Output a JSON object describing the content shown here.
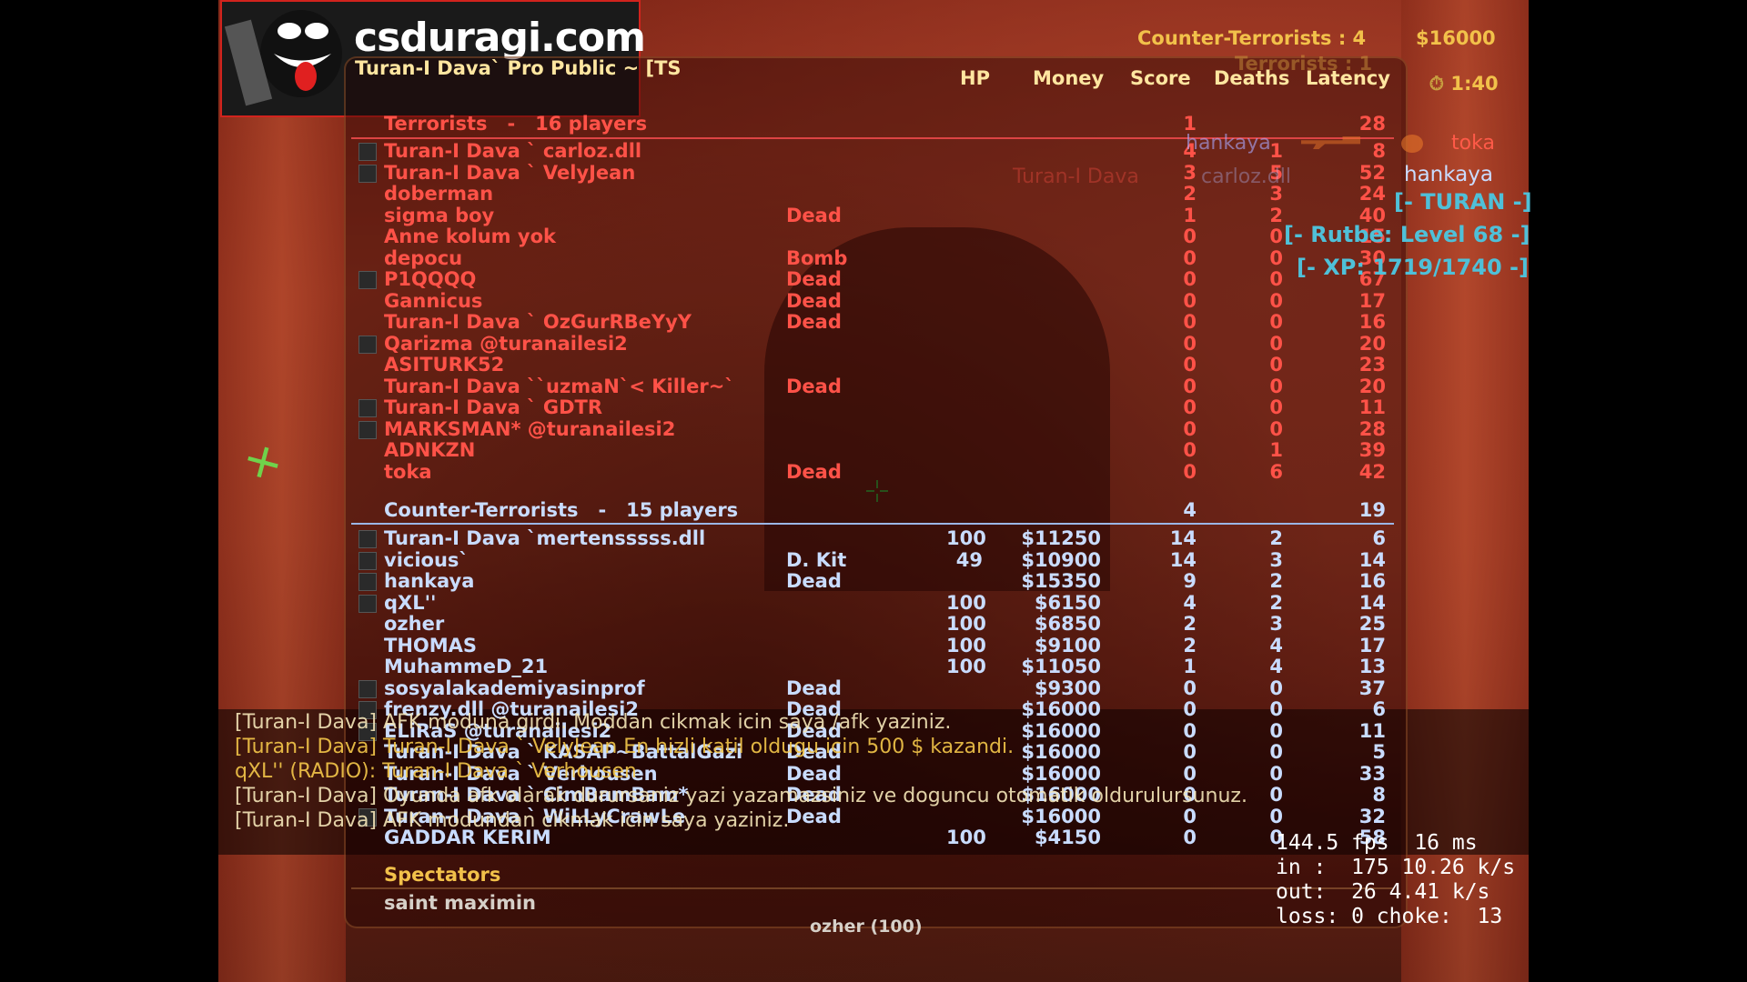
{
  "logo": {
    "text": "csduragi.com"
  },
  "server_name": "Turan-I Dava` Pro Public ~ [TS",
  "top_right": {
    "ct_score": "Counter-Terrorists : 4",
    "t_score": "Terrorists : 1",
    "money": "$16000",
    "timer": "1:40"
  },
  "columns": {
    "hp": "HP",
    "money": "Money",
    "score": "Score",
    "deaths": "Deaths",
    "latency": "Latency"
  },
  "terrorists": {
    "title": "Terrorists   -   16 players",
    "score": "1",
    "latency": "28",
    "players": [
      {
        "name": "Turan-I Dava ` carloz.dll",
        "status": "",
        "hp": "",
        "money": "",
        "score": "4",
        "deaths": "1",
        "latency": "8",
        "icon": true
      },
      {
        "name": "Turan-I Dava ` VelyJean",
        "status": "",
        "hp": "",
        "money": "",
        "score": "3",
        "deaths": "5",
        "latency": "52",
        "icon": true
      },
      {
        "name": "doberman",
        "status": "",
        "hp": "",
        "money": "",
        "score": "2",
        "deaths": "3",
        "latency": "24",
        "icon": false
      },
      {
        "name": "sigma boy",
        "status": "Dead",
        "hp": "",
        "money": "",
        "score": "1",
        "deaths": "2",
        "latency": "40",
        "icon": false
      },
      {
        "name": "Anne kolum yok",
        "status": "",
        "hp": "",
        "money": "",
        "score": "0",
        "deaths": "0",
        "latency": "15",
        "icon": false
      },
      {
        "name": "depocu",
        "status": "Bomb",
        "hp": "",
        "money": "",
        "score": "0",
        "deaths": "0",
        "latency": "30",
        "icon": false
      },
      {
        "name": "P1QQQQ",
        "status": "Dead",
        "hp": "",
        "money": "",
        "score": "0",
        "deaths": "0",
        "latency": "67",
        "icon": true
      },
      {
        "name": "Gannicus",
        "status": "Dead",
        "hp": "",
        "money": "",
        "score": "0",
        "deaths": "0",
        "latency": "17",
        "icon": false
      },
      {
        "name": "Turan-I Dava ` OzGurRBeYyY",
        "status": "Dead",
        "hp": "",
        "money": "",
        "score": "0",
        "deaths": "0",
        "latency": "16",
        "icon": false
      },
      {
        "name": "Qarizma @turanailesi2",
        "status": "",
        "hp": "",
        "money": "",
        "score": "0",
        "deaths": "0",
        "latency": "20",
        "icon": true
      },
      {
        "name": "ASITURK52",
        "status": "",
        "hp": "",
        "money": "",
        "score": "0",
        "deaths": "0",
        "latency": "23",
        "icon": false
      },
      {
        "name": "Turan-I Dava ``uzmaN`< Killer~`",
        "status": "Dead",
        "hp": "",
        "money": "",
        "score": "0",
        "deaths": "0",
        "latency": "20",
        "icon": false
      },
      {
        "name": "Turan-I Dava ` GDTR",
        "status": "",
        "hp": "",
        "money": "",
        "score": "0",
        "deaths": "0",
        "latency": "11",
        "icon": true
      },
      {
        "name": "MARKSMAN* @turanailesi2",
        "status": "",
        "hp": "",
        "money": "",
        "score": "0",
        "deaths": "0",
        "latency": "28",
        "icon": true
      },
      {
        "name": "ADNKZN",
        "status": "",
        "hp": "",
        "money": "",
        "score": "0",
        "deaths": "1",
        "latency": "39",
        "icon": false
      },
      {
        "name": "toka",
        "status": "Dead",
        "hp": "",
        "money": "",
        "score": "0",
        "deaths": "6",
        "latency": "42",
        "icon": false
      }
    ]
  },
  "counter_terrorists": {
    "title": "Counter-Terrorists   -   15 players",
    "score": "4",
    "latency": "19",
    "players": [
      {
        "name": "Turan-I Dava `mertensssss.dll",
        "status": "",
        "hp": "100",
        "money": "$11250",
        "score": "14",
        "deaths": "2",
        "latency": "6",
        "icon": true
      },
      {
        "name": "vicious`",
        "status": "D. Kit",
        "hp": "49",
        "money": "$10900",
        "score": "14",
        "deaths": "3",
        "latency": "14",
        "icon": true
      },
      {
        "name": "hankaya",
        "status": "Dead",
        "hp": "",
        "money": "$15350",
        "score": "9",
        "deaths": "2",
        "latency": "16",
        "icon": true
      },
      {
        "name": "qXL''",
        "status": "",
        "hp": "100",
        "money": "$6150",
        "score": "4",
        "deaths": "2",
        "latency": "14",
        "icon": true
      },
      {
        "name": "ozher",
        "status": "",
        "hp": "100",
        "money": "$6850",
        "score": "2",
        "deaths": "3",
        "latency": "25",
        "icon": false
      },
      {
        "name": "THOMAS",
        "status": "",
        "hp": "100",
        "money": "$9100",
        "score": "2",
        "deaths": "4",
        "latency": "17",
        "icon": false
      },
      {
        "name": "MuhammeD_21",
        "status": "",
        "hp": "100",
        "money": "$11050",
        "score": "1",
        "deaths": "4",
        "latency": "13",
        "icon": false
      },
      {
        "name": "sosyalakademiyasinprof",
        "status": "Dead",
        "hp": "",
        "money": "$9300",
        "score": "0",
        "deaths": "0",
        "latency": "37",
        "icon": true
      },
      {
        "name": "frenzy.dll @turanailesi2",
        "status": "Dead",
        "hp": "",
        "money": "$16000",
        "score": "0",
        "deaths": "0",
        "latency": "6",
        "icon": true
      },
      {
        "name": "ELiRaS @turanailesi2",
        "status": "Dead",
        "hp": "",
        "money": "$16000",
        "score": "0",
        "deaths": "0",
        "latency": "11",
        "icon": true
      },
      {
        "name": "Turan-I Dava ` KASAP~BattalGazi",
        "status": "Dead",
        "hp": "",
        "money": "$16000",
        "score": "0",
        "deaths": "0",
        "latency": "5",
        "icon": false
      },
      {
        "name": "Turan-I Dava ` Verhousen",
        "status": "Dead",
        "hp": "",
        "money": "$16000",
        "score": "0",
        "deaths": "0",
        "latency": "33",
        "icon": false
      },
      {
        "name": "Turan-I Dava ` CimBamBam*",
        "status": "Dead",
        "hp": "",
        "money": "$16000",
        "score": "0",
        "deaths": "0",
        "latency": "8",
        "icon": false
      },
      {
        "name": "Turan-I Dava ` WiLLyCrawLe",
        "status": "Dead",
        "hp": "",
        "money": "$16000",
        "score": "0",
        "deaths": "0",
        "latency": "32",
        "icon": true
      },
      {
        "name": "GADDAR KERIM",
        "status": "",
        "hp": "100",
        "money": "$4150",
        "score": "0",
        "deaths": "0",
        "latency": "58",
        "icon": false
      }
    ]
  },
  "spectators": {
    "title": "Spectators",
    "names": [
      "saint maximin"
    ]
  },
  "spectating": "ozher (100)",
  "killfeed": [
    {
      "killer": "hankaya",
      "victim": "toka"
    },
    {
      "killer": "Turan-I Dava",
      "victim": "carloz.dll"
    }
  ],
  "rank_panel": {
    "name": "hankaya",
    "lines": [
      "[- TURAN -]",
      "[- Rutbe: Level 68 -]",
      "[- XP: 1719/1740 -]"
    ]
  },
  "chat": [
    "[Turan-I Dava] AFK moduna girdi. Moddan cikmak icin saya /afk yaziniz.",
    "[Turan-I Dava] Turan-I Dava ` VelyJean En hizli katil oldugu icin 500 $ kazandi.",
    "qXL'' (RADIO): Turan-I Dava ` Verhousen",
    "[Turan-I Dava] Oyunda afk olarak durursaniz yazi yazamazsiniz ve doguncu otomatik oldurulursunuz.",
    "[Turan-I Dava] AFK modundan cikmak icin saya yaziniz."
  ],
  "net": {
    "fps": "144.5 fps  16 ms",
    "in": "in :  175 10.26 k/s",
    "out": "out:  26 4.41 k/s",
    "loss": "loss: 0 choke:  13"
  }
}
